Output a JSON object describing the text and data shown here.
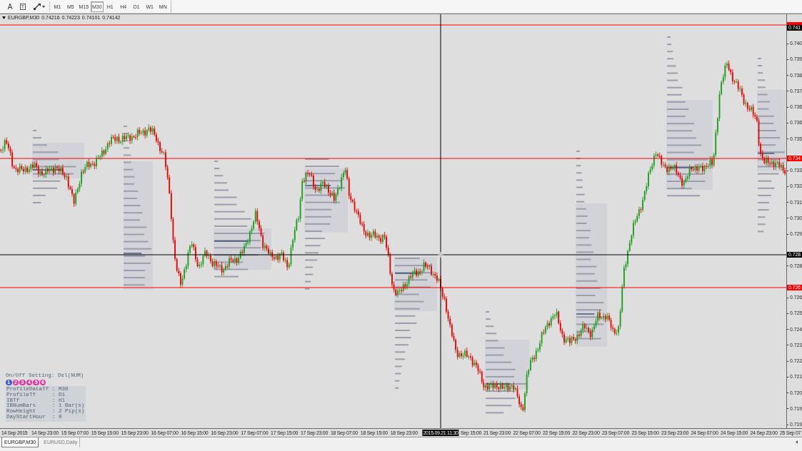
{
  "toolbar": {
    "tools": [
      {
        "kind": "glyph",
        "glyph": "A"
      },
      {
        "kind": "boxed-glyph",
        "glyph": "T"
      },
      {
        "kind": "shapes-menu"
      }
    ],
    "timeframes": [
      {
        "label": "M1",
        "selected": false
      },
      {
        "label": "M5",
        "selected": false
      },
      {
        "label": "M15",
        "selected": false
      },
      {
        "label": "M30",
        "selected": true
      },
      {
        "label": "H1",
        "selected": false
      },
      {
        "label": "H4",
        "selected": false
      },
      {
        "label": "D1",
        "selected": false
      },
      {
        "label": "W1",
        "selected": false
      },
      {
        "label": "MN",
        "selected": false
      }
    ]
  },
  "chart": {
    "symbol": "EURGBP,M30",
    "quotes": [
      "0.74216",
      "0.74223",
      "0.74101",
      "0.74142"
    ],
    "price_axis": {
      "labels": [
        "0.740",
        "0.739",
        "0.738",
        "0.737",
        "0.736",
        "0.736",
        "0.735",
        "0.733",
        "0.732",
        "0.731",
        "0.730",
        "0.729",
        "0.728",
        "0.726",
        "0.725",
        "0.724",
        "0.723",
        "0.722",
        "0.721",
        "0.720",
        "0.719",
        "0.719"
      ]
    },
    "price_markers": [
      {
        "kind": "line",
        "color": "#ff0000"
      },
      {
        "kind": "quote",
        "label": "0.741",
        "color": "#000000"
      },
      {
        "kind": "line",
        "label": "0.734",
        "color": "#ff0000"
      },
      {
        "kind": "line",
        "label": "0.726",
        "color": "#ff0000"
      }
    ],
    "crosshair": {
      "price_label": "0.728",
      "time_label": "2015.09.21 11:30"
    },
    "time_axis": {
      "labels": [
        "14 Sep 2015",
        "14 Sep 23:00",
        "15 Sep 07:00",
        "15 Sep 15:00",
        "15 Sep 23:00",
        "16 Sep 07:00",
        "16 Sep 15:00",
        "16 Sep 23:00",
        "17 Sep 07:00",
        "17 Sep 15:00",
        "17 Sep 23:00",
        "18 Sep 07:00",
        "18 Sep 15:00",
        "18 Sep 23:00",
        "Sep 15:00",
        "21 Sep 23:00",
        "22 Sep 07:00",
        "22 Sep 15:00",
        "22 Sep 23:00",
        "23 Sep 07:00",
        "23 Sep 15:00",
        "23 Sep 23:00",
        "24 Sep 07:00",
        "24 Sep 15:00",
        "24 Sep 23:00",
        "25 Sep 07"
      ]
    },
    "profile_panel": {
      "title": "On/Off Setting: Del(NUM)",
      "modes": [
        {
          "label": "1",
          "selected": true
        },
        {
          "label": "2",
          "selected": false
        },
        {
          "label": "3",
          "selected": false
        },
        {
          "label": "4",
          "selected": false
        },
        {
          "label": "5",
          "selected": false
        },
        {
          "label": "6",
          "selected": false
        }
      ],
      "settings": [
        "ProfileDataTf : M30",
        "ProfileTf     : D1",
        "IBTf          : H1",
        "IBNumBars     : 1 Bar(s)",
        "RowHeight     : 2 Pip(s)",
        "DayStartHour  : 0"
      ]
    }
  },
  "tabs": [
    {
      "label": "EURGBP,M30",
      "selected": true
    },
    {
      "label": "EURUSD,Daily",
      "selected": false
    }
  ]
}
